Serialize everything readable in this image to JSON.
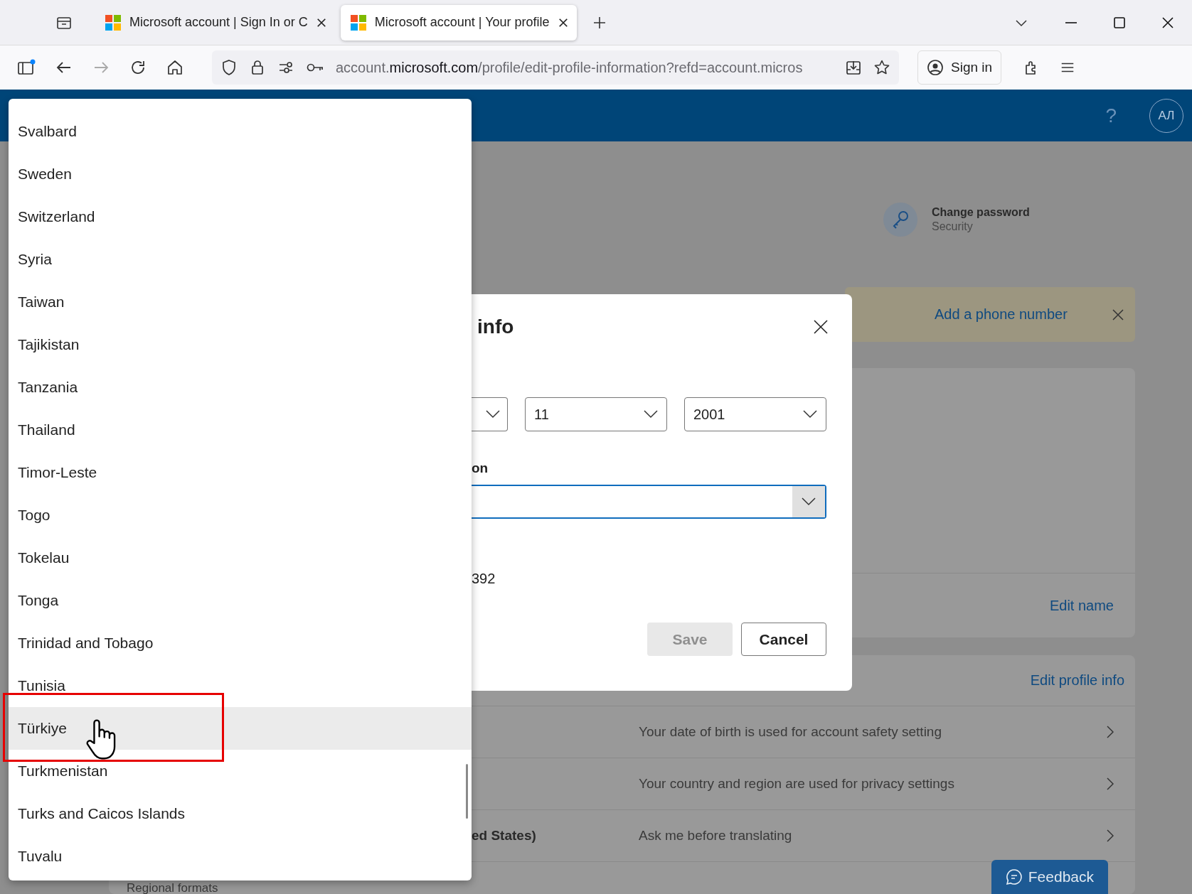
{
  "browser": {
    "tabs": [
      {
        "title": "Microsoft account | Sign In or C",
        "selected": false
      },
      {
        "title": "Microsoft account | Your profile",
        "selected": true
      }
    ],
    "url": {
      "prefix": "account.",
      "domain": "microsoft.com",
      "path": "/profile/edit-profile-information?refd=account.micros"
    },
    "sign_in": "Sign in"
  },
  "header": {
    "help": "?",
    "avatar": "АЛ"
  },
  "security": {
    "title": "Change password",
    "subtitle": "Security"
  },
  "banner": {
    "link": "Add a phone number"
  },
  "name_card": {
    "link": "Edit name"
  },
  "profile_card": {
    "link": "Edit profile info",
    "rows": [
      {
        "value": "",
        "description": "Your date of birth is used for account safety setting"
      },
      {
        "value": "",
        "description": "Your country and region are used for privacy settings"
      },
      {
        "value": "ed States)",
        "description": "Ask me before translating"
      }
    ],
    "next_row": "Regional formats"
  },
  "feedback": "Feedback",
  "dialog": {
    "title": "info",
    "birth_day": "11",
    "birth_year": "2001",
    "region_label": "on",
    "number": "392",
    "save": {
      "label": "Save",
      "disabled": true
    },
    "cancel": "Cancel"
  },
  "dropdown": {
    "options": [
      {
        "label": "Svalbard",
        "highlighted": false
      },
      {
        "label": "Sweden",
        "highlighted": false
      },
      {
        "label": "Switzerland",
        "highlighted": false
      },
      {
        "label": "Syria",
        "highlighted": false
      },
      {
        "label": "Taiwan",
        "highlighted": false
      },
      {
        "label": "Tajikistan",
        "highlighted": false
      },
      {
        "label": "Tanzania",
        "highlighted": false
      },
      {
        "label": "Thailand",
        "highlighted": false
      },
      {
        "label": "Timor-Leste",
        "highlighted": false
      },
      {
        "label": "Togo",
        "highlighted": false
      },
      {
        "label": "Tokelau",
        "highlighted": false
      },
      {
        "label": "Tonga",
        "highlighted": false
      },
      {
        "label": "Trinidad and Tobago",
        "highlighted": false
      },
      {
        "label": "Tunisia",
        "highlighted": false
      },
      {
        "label": "Türkiye",
        "highlighted": true
      },
      {
        "label": "Turkmenistan",
        "highlighted": false
      },
      {
        "label": "Turks and Caicos Islands",
        "highlighted": false
      },
      {
        "label": "Tuvalu",
        "highlighted": false
      }
    ]
  }
}
